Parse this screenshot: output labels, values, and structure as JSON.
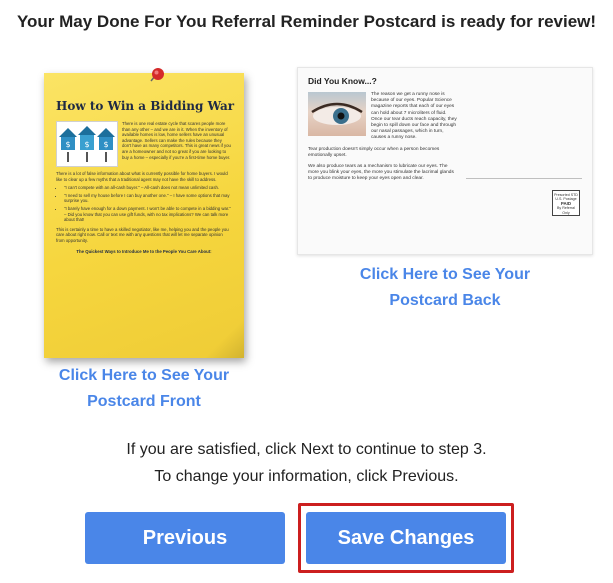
{
  "headline": "Your May Done For You Referral Reminder Postcard is ready for review!",
  "front": {
    "title": "How to Win a Bidding War",
    "intro": "There is one real estate cycle that scares people more than any other – and we are in it. When the inventory of available homes is low, home sellers have an unusual advantage. Sellers can make the rules because they don't have as many competitors. This is great news if you are a homeowner and not so great if you are looking to buy a home – especially if you're a first-time home buyer.",
    "para2": "There is a lot of false information about what is currently possible for home buyers. I would like to clear up a few myths that a traditional agent may not have the skill to address.",
    "bullets": [
      "\"I can't compete with an all-cash buyer.\" – All-cash does not mean unlimited cash.",
      "\"I need to sell my house before I can buy another one.\" – I have some options that may surprise you.",
      "\"I barely have enough for a down payment. I won't be able to compete in a bidding war.\" – Did you know that you can use gift funds, with no tax implications? We can talk more about that!"
    ],
    "para3": "This is certainly a time to have a skilled negotiator, like me, helping you and the people you care about right now. Call or text me with any questions that will let me separate opinion from opportunity.",
    "cta": "The Quickest Ways to Introduce Me to the People You Care About:",
    "link_line1": "Click Here to See Your",
    "link_line2": "Postcard Front"
  },
  "back": {
    "heading": "Did You Know...?",
    "para1": "The reason we get a runny nose is because of our eyes. Popular Science magazine reports that each of our eyes can hold about 7 microliters of fluid. Once our tear ducts reach capacity, they begin to spill down our face and through our nasal passages, which in turn, causes a runny nose.",
    "para2": "Tear production doesn't simply occur when a person becomes emotionally upset.",
    "para3": "We also produce tears as a mechanism to lubricate our eyes. The more you blink your eyes, the more you stimulate the lacrimal glands to produce moisture to keep your eyes open and clear.",
    "stamp_line1": "Presorted STD",
    "stamp_line2": "U.S. Postage",
    "stamp_line3": "PAID",
    "stamp_line4": "By Referral Only",
    "link_line1": "Click Here to See Your",
    "link_line2": "Postcard Back"
  },
  "note_line1": "If you are satisfied, click Next to continue to step 3.",
  "note_line2": "To change your information, click Previous.",
  "buttons": {
    "previous": "Previous",
    "save": "Save Changes"
  },
  "colors": {
    "accent": "#4a86e8",
    "highlight": "#cc1f1f",
    "sticky_note": "#f6d63e"
  }
}
